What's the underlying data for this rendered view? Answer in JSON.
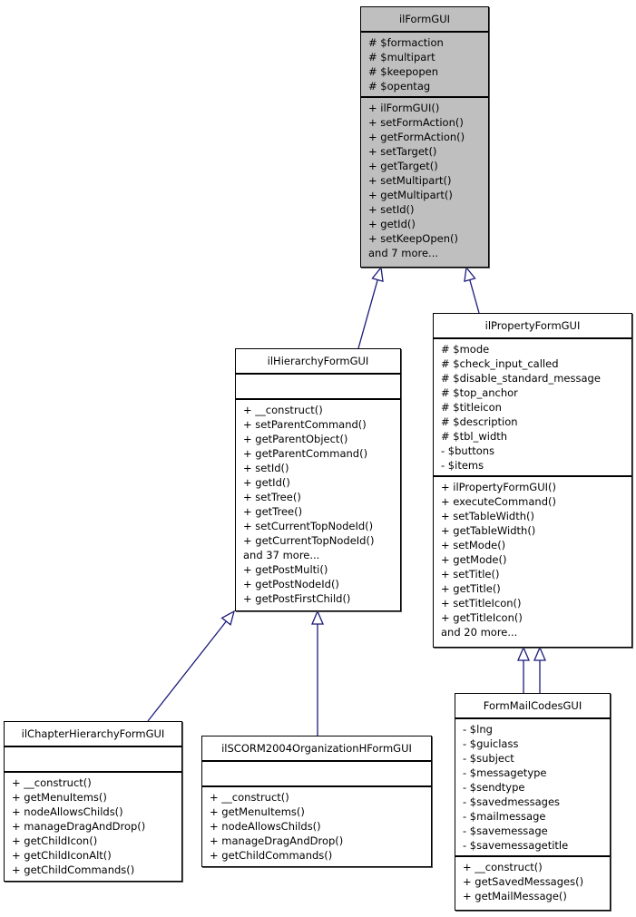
{
  "diagram": {
    "type": "uml-class-inheritance",
    "edge_color": "#1a1a7a",
    "root_fill": "#bfbfbf",
    "classes": [
      {
        "id": "ilFormGUI",
        "name": "ilFormGUI",
        "attributes": [
          "# $formaction",
          "# $multipart",
          "# $keepopen",
          "# $opentag"
        ],
        "methods": [
          "+ ilFormGUI()",
          "+ setFormAction()",
          "+ getFormAction()",
          "+ setTarget()",
          "+ getTarget()",
          "+ setMultipart()",
          "+ getMultipart()",
          "+ setId()",
          "+ getId()",
          "+ setKeepOpen()",
          "and 7 more..."
        ]
      },
      {
        "id": "ilHierarchyFormGUI",
        "name": "ilHierarchyFormGUI",
        "attributes": [],
        "methods": [
          "+ __construct()",
          "+ setParentCommand()",
          "+ getParentObject()",
          "+ getParentCommand()",
          "+ setId()",
          "+ getId()",
          "+ setTree()",
          "+ getTree()",
          "+ setCurrentTopNodeId()",
          "+ getCurrentTopNodeId()",
          "and 37 more...",
          "+ getPostMulti()",
          "+ getPostNodeId()",
          "+ getPostFirstChild()"
        ]
      },
      {
        "id": "ilPropertyFormGUI",
        "name": "ilPropertyFormGUI",
        "attributes": [
          "# $mode",
          "# $check_input_called",
          "# $disable_standard_message",
          "# $top_anchor",
          "# $titleicon",
          "# $description",
          "# $tbl_width",
          "- $buttons",
          "- $items"
        ],
        "methods": [
          "+ ilPropertyFormGUI()",
          "+ executeCommand()",
          "+ setTableWidth()",
          "+ getTableWidth()",
          "+ setMode()",
          "+ getMode()",
          "+ setTitle()",
          "+ getTitle()",
          "+ setTitleIcon()",
          "+ getTitleIcon()",
          "and 20 more..."
        ]
      },
      {
        "id": "ilChapterHierarchyFormGUI",
        "name": "ilChapterHierarchyFormGUI",
        "attributes": [],
        "methods": [
          "+ __construct()",
          "+ getMenuItems()",
          "+ nodeAllowsChilds()",
          "+ manageDragAndDrop()",
          "+ getChildIcon()",
          "+ getChildIconAlt()",
          "+ getChildCommands()"
        ]
      },
      {
        "id": "ilSCORM2004OrganizationHFormGUI",
        "name": "ilSCORM2004OrganizationHFormGUI",
        "attributes": [],
        "methods": [
          "+ __construct()",
          "+ getMenuItems()",
          "+ nodeAllowsChilds()",
          "+ manageDragAndDrop()",
          "+ getChildCommands()"
        ]
      },
      {
        "id": "FormMailCodesGUI",
        "name": "FormMailCodesGUI",
        "attributes": [
          "- $lng",
          "- $guiclass",
          "- $subject",
          "- $messagetype",
          "- $sendtype",
          "- $savedmessages",
          "- $mailmessage",
          "- $savemessage",
          "- $savemessagetitle"
        ],
        "methods": [
          "+ __construct()",
          "+ getSavedMessages()",
          "+ getMailMessage()"
        ]
      }
    ],
    "edges": [
      {
        "from": "ilHierarchyFormGUI",
        "to": "ilFormGUI",
        "kind": "inheritance"
      },
      {
        "from": "ilPropertyFormGUI",
        "to": "ilFormGUI",
        "kind": "inheritance"
      },
      {
        "from": "ilChapterHierarchyFormGUI",
        "to": "ilHierarchyFormGUI",
        "kind": "inheritance"
      },
      {
        "from": "ilSCORM2004OrganizationHFormGUI",
        "to": "ilHierarchyFormGUI",
        "kind": "inheritance"
      },
      {
        "from": "FormMailCodesGUI",
        "to": "ilPropertyFormGUI",
        "kind": "inheritance"
      },
      {
        "from": "FormMailCodesGUI",
        "to": "ilPropertyFormGUI",
        "kind": "inheritance"
      }
    ]
  }
}
